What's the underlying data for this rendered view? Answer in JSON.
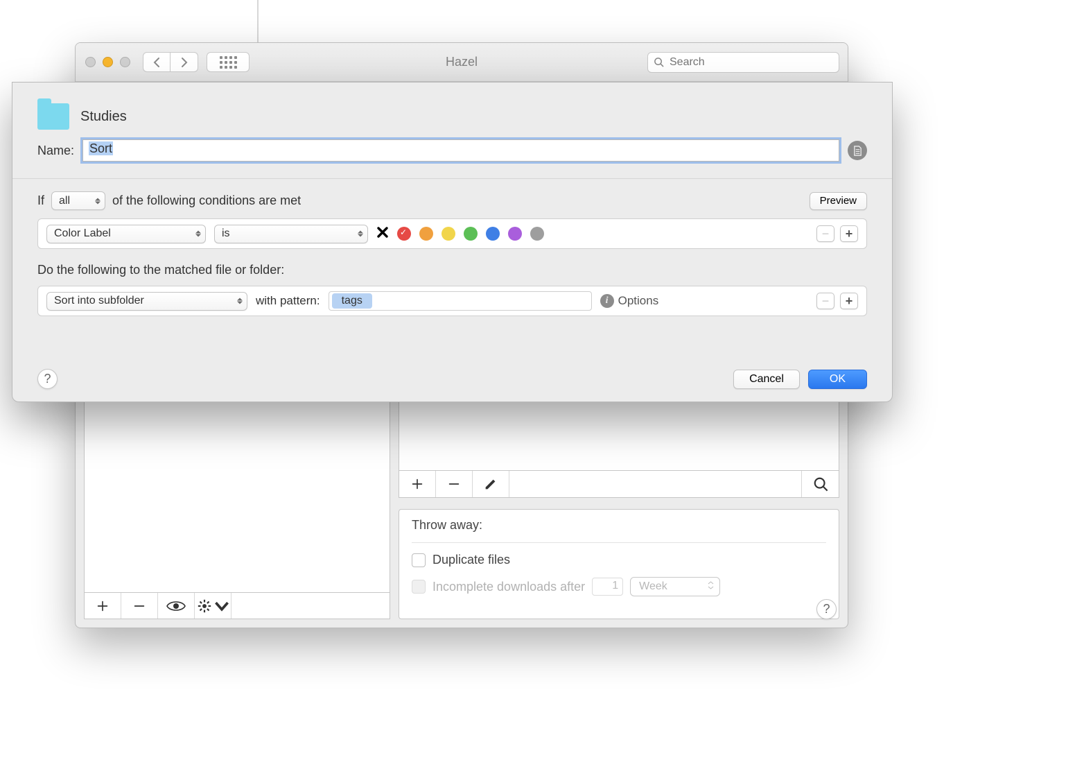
{
  "window": {
    "title": "Hazel",
    "search_placeholder": "Search"
  },
  "left_toolbar": {
    "add": "+",
    "remove": "−"
  },
  "rules_toolbar": {
    "add": "+",
    "remove": "−"
  },
  "throw_away": {
    "heading": "Throw away:",
    "duplicate_label": "Duplicate files",
    "incomplete_label": "Incomplete downloads after",
    "incomplete_value": "1",
    "incomplete_unit": "Week"
  },
  "sheet": {
    "folder_name": "Studies",
    "name_label": "Name:",
    "rule_name": "Sort",
    "if_prefix": "If",
    "match_mode": "all",
    "if_suffix": "of the following conditions are met",
    "preview_button": "Preview",
    "condition": {
      "attribute": "Color Label",
      "operator": "is",
      "colors": [
        "red",
        "orange",
        "yellow",
        "green",
        "blue",
        "purple",
        "gray"
      ]
    },
    "do_label": "Do the following to the matched file or folder:",
    "action": {
      "name": "Sort into subfolder",
      "pattern_label": "with pattern:",
      "pattern_token": "tags",
      "options_label": "Options"
    },
    "buttons": {
      "cancel": "Cancel",
      "ok": "OK"
    },
    "help": "?"
  },
  "help": "?"
}
